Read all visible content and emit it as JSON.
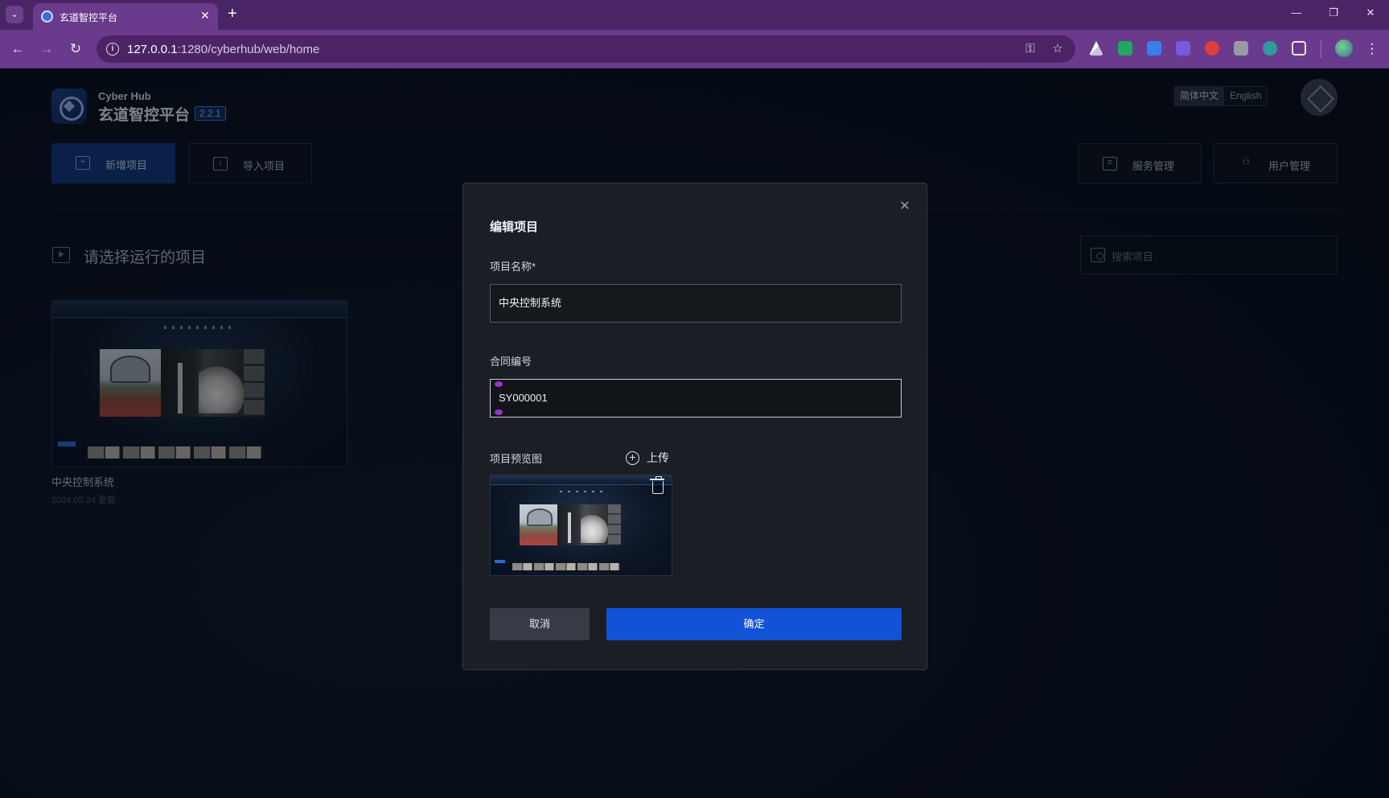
{
  "browser": {
    "tab_title": "玄道智控平台",
    "url_host": "127.0.0.1",
    "url_path": ":1280/cyberhub/web/home"
  },
  "app": {
    "brand_en": "Cyber Hub",
    "brand_cn": "玄道智控平台",
    "version": "2.2.1",
    "lang_options": [
      "简体中文",
      "English"
    ],
    "buttons": {
      "new_project": "新增项目",
      "import_project": "导入项目",
      "service_mgmt": "服务管理",
      "user_mgmt": "用户管理"
    },
    "section_title": "请选择运行的项目",
    "search_placeholder": "搜索项目",
    "projects": [
      {
        "name": "中央控制系统",
        "updated": "2024.05.24 更新"
      }
    ]
  },
  "modal": {
    "title": "编辑项目",
    "name_label": "项目名称*",
    "name_value": "中央控制系统",
    "contract_label": "合同编号",
    "contract_value": "SY000001",
    "preview_label": "项目预览图",
    "upload_label": "上传",
    "cancel_label": "取消",
    "ok_label": "确定"
  },
  "colors": {
    "browser_frame": "#6a3a8c",
    "accent_blue": "#1252d6",
    "modal_bg": "#1b1e24",
    "page_bg": "#0a1120"
  }
}
